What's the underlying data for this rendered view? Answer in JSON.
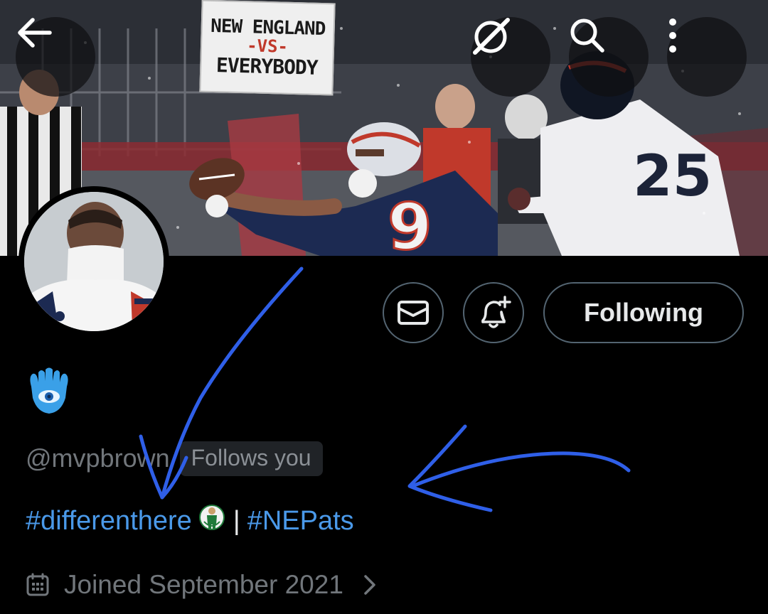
{
  "banner": {
    "sign": {
      "line1": "NEW ENGLAND",
      "line2": "-VS-",
      "line3": "EVERYBODY"
    },
    "back_icon": "arrow-left-icon",
    "grok_icon": "grok-icon",
    "search_icon": "search-icon",
    "more_icon": "more-vertical-icon"
  },
  "profile": {
    "handle": "@mvpbrown",
    "follows_you": "Follows you",
    "bio": {
      "tag1": "#differenthere",
      "separator": "|",
      "tag2": "#NEPats"
    },
    "joined": "Joined September 2021"
  },
  "actions": {
    "message_icon": "mail-icon",
    "notify_icon": "bell-plus-icon",
    "following_label": "Following"
  },
  "colors": {
    "background": "#000000",
    "link": "#4a99e9",
    "muted": "#71767b",
    "border": "#536471",
    "annotation": "#2f5fe8"
  }
}
